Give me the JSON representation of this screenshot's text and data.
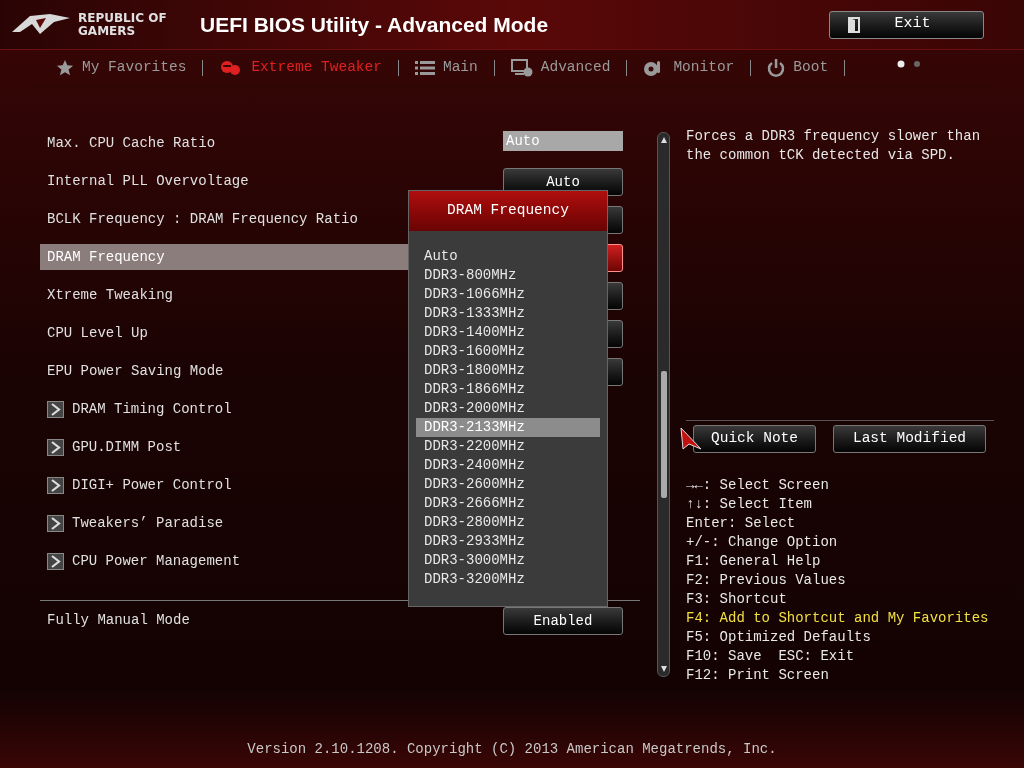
{
  "header": {
    "logo_text": "REPUBLIC OF GAMERS",
    "title": "UEFI BIOS Utility - Advanced Mode",
    "exit_button": "Exit"
  },
  "tabs": [
    {
      "label": "My Favorites",
      "selected": false
    },
    {
      "label": "Extreme Tweaker",
      "selected": true
    },
    {
      "label": "Main",
      "selected": false
    },
    {
      "label": "Advanced",
      "selected": false
    },
    {
      "label": "Monitor",
      "selected": false
    },
    {
      "label": "Boot",
      "selected": false
    }
  ],
  "settings": [
    {
      "kind": "field",
      "label": "Max. CPU Cache Ratio",
      "value": "Auto",
      "selected": false
    },
    {
      "kind": "select",
      "label": "Internal PLL Overvoltage",
      "value": "Auto",
      "selected": false
    },
    {
      "kind": "select",
      "label": "BCLK Frequency : DRAM Frequency Ratio",
      "selected": false
    },
    {
      "kind": "select",
      "label": "DRAM Frequency",
      "selected": true
    },
    {
      "kind": "select",
      "label": "Xtreme Tweaking",
      "selected": false
    },
    {
      "kind": "select",
      "label": "CPU Level Up",
      "selected": false
    },
    {
      "kind": "select",
      "label": "EPU Power Saving Mode",
      "selected": false
    },
    {
      "kind": "submenu",
      "label": "DRAM Timing Control",
      "selected": false
    },
    {
      "kind": "submenu",
      "label": "GPU.DIMM Post",
      "selected": false
    },
    {
      "kind": "submenu",
      "label": "DIGI+ Power Control",
      "selected": false
    },
    {
      "kind": "submenu",
      "label": "Tweakers’ Paradise",
      "selected": false
    },
    {
      "kind": "submenu",
      "label": "CPU Power Management",
      "selected": false
    },
    {
      "kind": "separator"
    },
    {
      "kind": "select",
      "label": "Fully Manual Mode",
      "value": "Enabled",
      "selected": false
    }
  ],
  "dropdown": {
    "title": "DRAM Frequency",
    "options": [
      {
        "label": "Auto",
        "selected": false
      },
      {
        "label": "DDR3-800MHz",
        "selected": false
      },
      {
        "label": "DDR3-1066MHz",
        "selected": false
      },
      {
        "label": "DDR3-1333MHz",
        "selected": false
      },
      {
        "label": "DDR3-1400MHz",
        "selected": false
      },
      {
        "label": "DDR3-1600MHz",
        "selected": false
      },
      {
        "label": "DDR3-1800MHz",
        "selected": false
      },
      {
        "label": "DDR3-1866MHz",
        "selected": false
      },
      {
        "label": "DDR3-2000MHz",
        "selected": false
      },
      {
        "label": "DDR3-2133MHz",
        "selected": true
      },
      {
        "label": "DDR3-2200MHz",
        "selected": false
      },
      {
        "label": "DDR3-2400MHz",
        "selected": false
      },
      {
        "label": "DDR3-2600MHz",
        "selected": false
      },
      {
        "label": "DDR3-2666MHz",
        "selected": false
      },
      {
        "label": "DDR3-2800MHz",
        "selected": false
      },
      {
        "label": "DDR3-2933MHz",
        "selected": false
      },
      {
        "label": "DDR3-3000MHz",
        "selected": false
      },
      {
        "label": "DDR3-3200MHz",
        "selected": false
      }
    ]
  },
  "help_panel": {
    "description": "Forces a DDR3 frequency slower than the common tCK detected via SPD.",
    "buttons": [
      "Quick Note",
      "Last Modified"
    ],
    "keys": [
      {
        "text": "→←: Select Screen",
        "highlighted": false
      },
      {
        "text": "↑↓: Select Item",
        "highlighted": false
      },
      {
        "text": "Enter: Select",
        "highlighted": false
      },
      {
        "text": "+/-: Change Option",
        "highlighted": false
      },
      {
        "text": "F1: General Help",
        "highlighted": false
      },
      {
        "text": "F2: Previous Values",
        "highlighted": false
      },
      {
        "text": "F3: Shortcut",
        "highlighted": false
      },
      {
        "text": "F4: Add to Shortcut and My Favorites",
        "highlighted": true
      },
      {
        "text": "F5: Optimized Defaults",
        "highlighted": false
      },
      {
        "text": "F10: Save  ESC: Exit",
        "highlighted": false
      },
      {
        "text": "F12: Print Screen",
        "highlighted": false
      }
    ]
  },
  "footer": "Version 2.10.1208. Copyright (C) 2013 American Megatrends, Inc."
}
